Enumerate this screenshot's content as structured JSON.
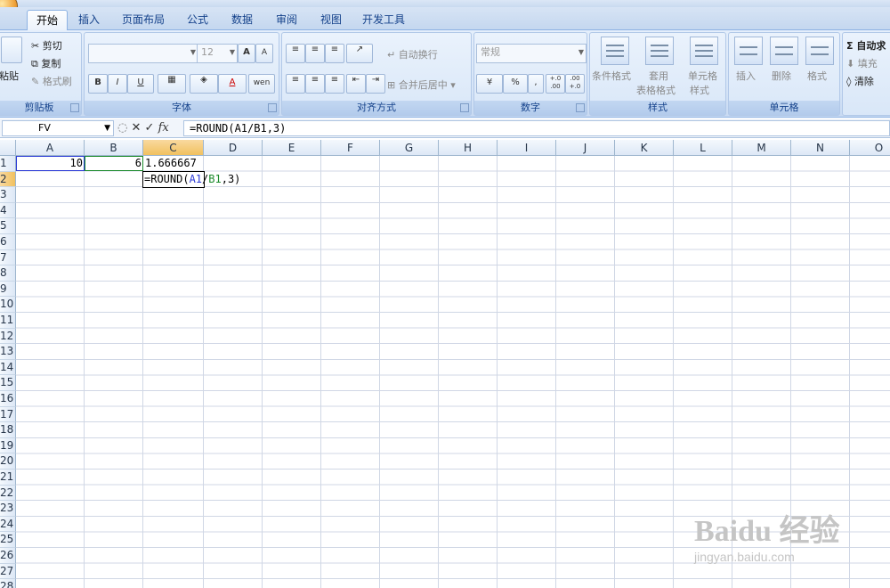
{
  "window": {
    "title_partial": "..."
  },
  "tabs": [
    "开始",
    "插入",
    "页面布局",
    "公式",
    "数据",
    "审阅",
    "视图",
    "开发工具"
  ],
  "ribbon": {
    "clipboard": {
      "label": "剪贴板",
      "paste": "粘贴",
      "cut": "剪切",
      "copy": "复制",
      "format_painter": "格式刷"
    },
    "font": {
      "label": "字体",
      "font_name": "",
      "font_size": "12",
      "bold": "B",
      "italic": "I",
      "underline": "U",
      "grow": "A",
      "shrink": "A",
      "font_color": "A",
      "phonetic": "wen"
    },
    "alignment": {
      "label": "对齐方式",
      "wrap_text": "自动换行",
      "merge_center": "合并后居中"
    },
    "number": {
      "label": "数字",
      "format": "常规",
      "currency": "¥",
      "percent": "%",
      "comma": ",",
      "inc_decimal": "+.0 .00",
      "dec_decimal": ".00 +.0"
    },
    "styles": {
      "label": "样式",
      "conditional": "条件格式",
      "table_style_1": "套用",
      "table_style_2": "表格格式",
      "cell_style_1": "单元格",
      "cell_style_2": "样式"
    },
    "cells": {
      "label": "单元格",
      "insert": "插入",
      "delete": "删除",
      "format": "格式"
    },
    "editing": {
      "autosum": "Σ 自动求",
      "fill": "填充",
      "clear": "清除"
    }
  },
  "formula_bar": {
    "name_box": "FV",
    "cancel": "✕",
    "enter": "✓",
    "fx": "fx",
    "content": "=ROUND(A1/B1,3)"
  },
  "grid": {
    "columns": [
      "A",
      "B",
      "C",
      "D",
      "E",
      "F",
      "G",
      "H",
      "I",
      "J",
      "K",
      "L",
      "M",
      "N",
      "O"
    ],
    "rows": [
      "1",
      "2",
      "3",
      "4",
      "5",
      "6",
      "7",
      "8",
      "9",
      "10",
      "11",
      "12",
      "13",
      "14",
      "15",
      "16",
      "17",
      "18",
      "19",
      "20",
      "21",
      "22",
      "23",
      "24",
      "25",
      "26",
      "27",
      "28"
    ],
    "cells": {
      "A1": "10",
      "B1": "6",
      "C1": "1.666667",
      "C2_prefix": "=ROUND(",
      "C2_ref1": "A1",
      "C2_slash": "/",
      "C2_ref2": "B1",
      "C2_suffix": ",3)"
    }
  },
  "watermark": {
    "line1": "Baidu 经验",
    "line2": "jingyan.baidu.com"
  },
  "colors": {
    "ref_a1": "#2c3bd6",
    "ref_b1": "#1a8a2a",
    "selected_header": "#f5c96a"
  }
}
